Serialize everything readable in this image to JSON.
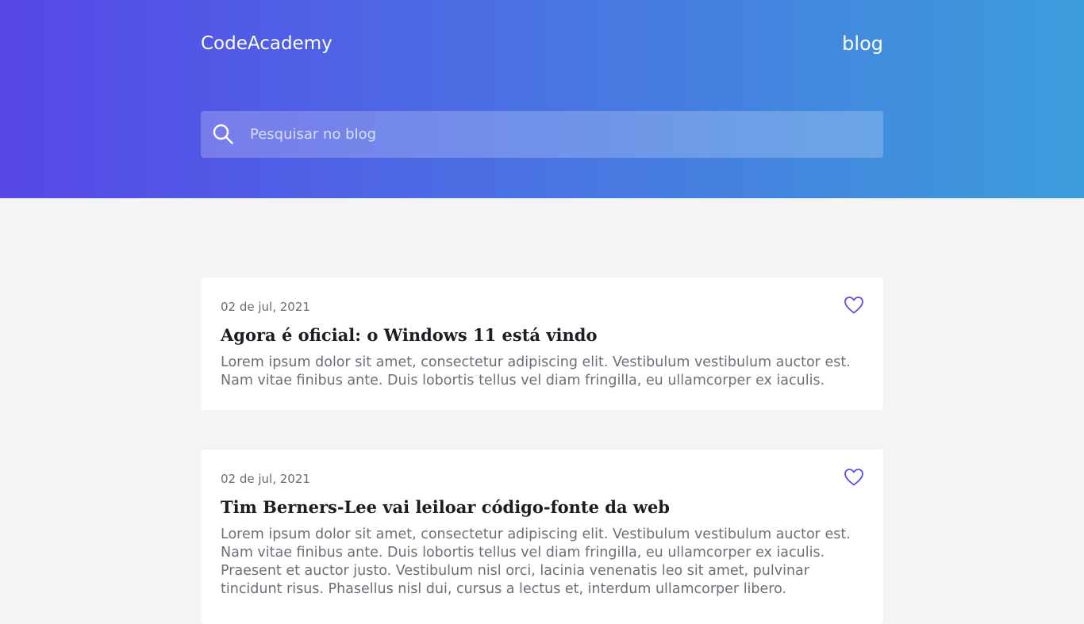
{
  "header": {
    "brand": "CodeAcademy",
    "nav_link": "blog"
  },
  "search": {
    "placeholder": "Pesquisar no blog",
    "value": ""
  },
  "colors": {
    "gradient_start": "#5747e7",
    "gradient_end": "#3c9ddb",
    "accent": "#5b4ee8",
    "page_background": "#f3f4f6"
  },
  "icons": {
    "search": "search-icon",
    "like": "heart-icon"
  },
  "posts": [
    {
      "date": "02 de jul, 2021",
      "title": "Agora é oficial: o Windows 11 está vindo",
      "excerpt": "Lorem ipsum dolor sit amet, consectetur adipiscing elit. Vestibulum vestibulum auctor est. Nam vitae finibus ante. Duis lobortis tellus vel diam fringilla, eu ullamcorper ex iaculis."
    },
    {
      "date": "02 de jul, 2021",
      "title": "Tim Berners-Lee vai leiloar código-fonte da web",
      "excerpt": "Lorem ipsum dolor sit amet, consectetur adipiscing elit. Vestibulum vestibulum auctor est. Nam vitae finibus ante. Duis lobortis tellus vel diam fringilla, eu ullamcorper ex iaculis. Praesent et auctor justo. Vestibulum nisl orci, lacinia venenatis leo sit amet, pulvinar tincidunt risus. Phasellus nisl dui, cursus a lectus et, interdum ullamcorper libero."
    }
  ]
}
